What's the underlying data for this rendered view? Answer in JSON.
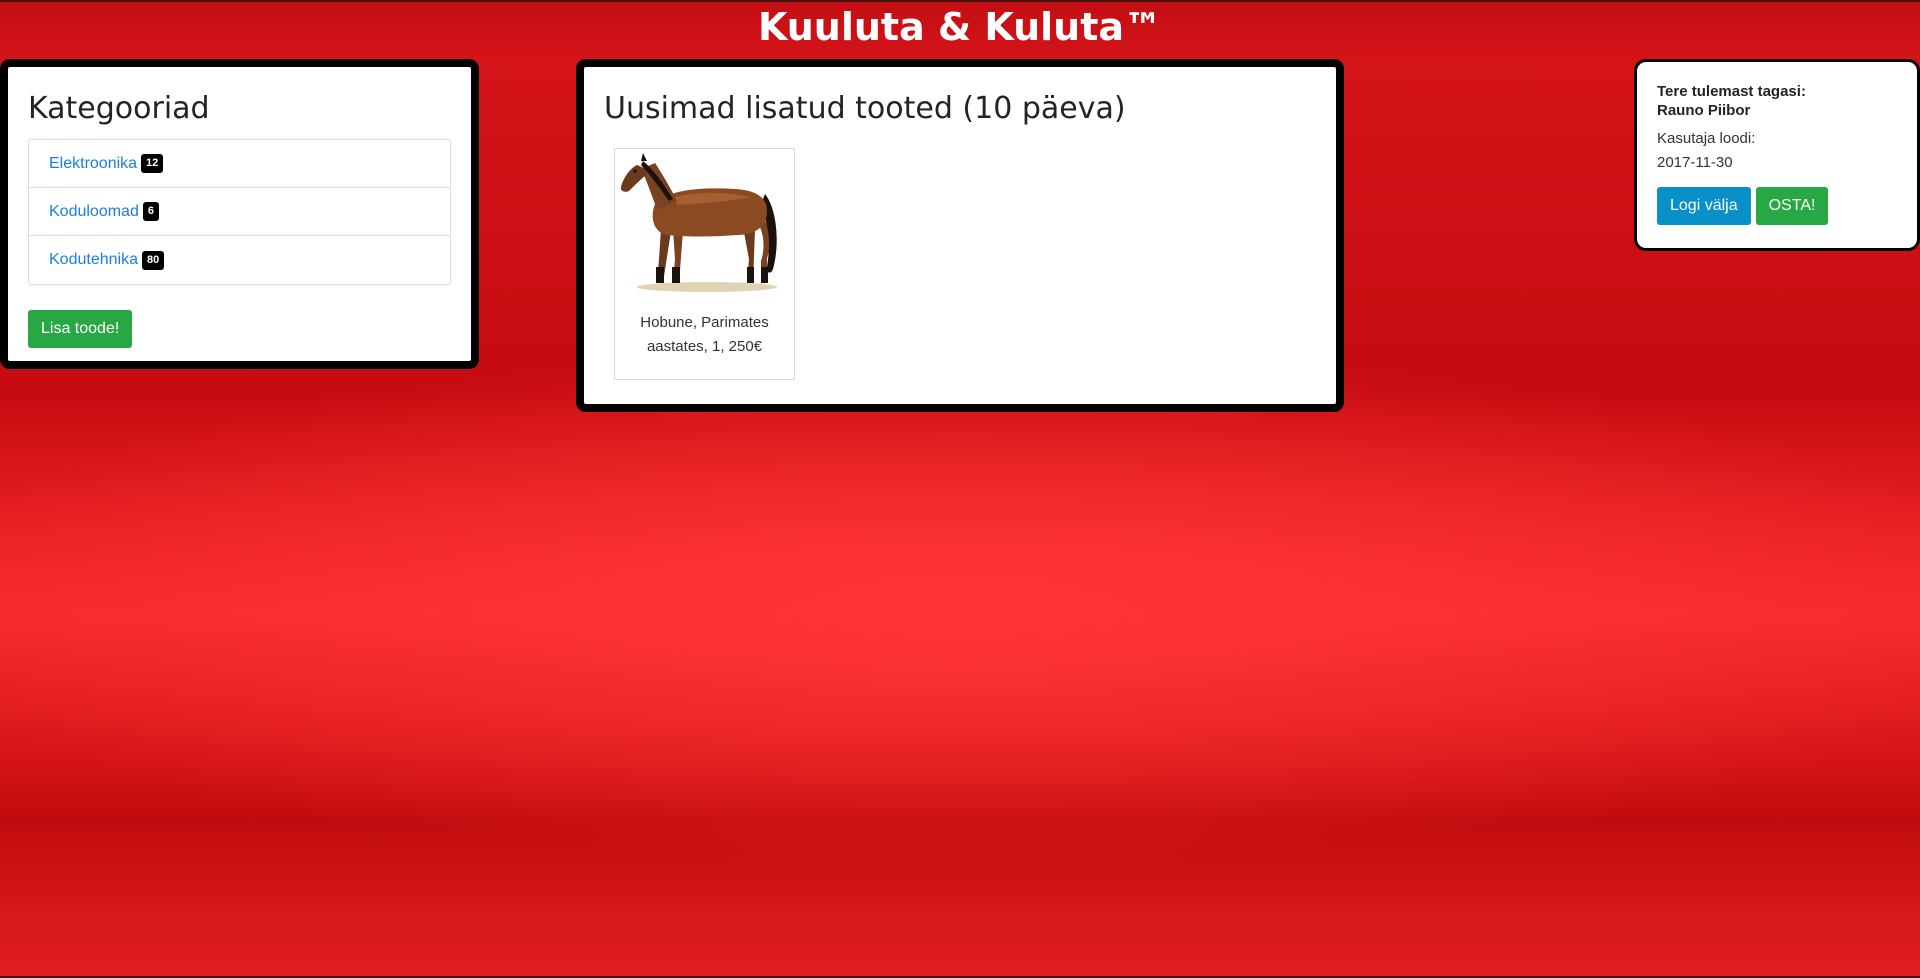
{
  "header": {
    "title": "Kuuluta & Kuluta™"
  },
  "categories": {
    "title": "Kategooriad",
    "items": [
      {
        "label": "Elektroonika",
        "count": "12"
      },
      {
        "label": "Koduloomad",
        "count": "6"
      },
      {
        "label": "Kodutehnika",
        "count": "80"
      }
    ],
    "add_button_label": "Lisa toode!"
  },
  "new_products": {
    "title": "Uusimad lisatud tooted (10 päeva)",
    "items": [
      {
        "caption": "Hobune, Parimates aastates, 1, 250€",
        "image": "horse"
      }
    ]
  },
  "user": {
    "greeting": "Tere tulemast tagasi:",
    "name": "Rauno Piibor",
    "created_label": "Kasutaja loodi:",
    "created_date": "2017-11-30",
    "logout_label": "Logi välja",
    "buy_label": "OSTA!"
  },
  "colors": {
    "background": "#d8161b",
    "panel_border": "#000000",
    "link": "#1a7ee6",
    "success": "#28a745",
    "info": "#0a90c9",
    "badge": "#000000"
  }
}
